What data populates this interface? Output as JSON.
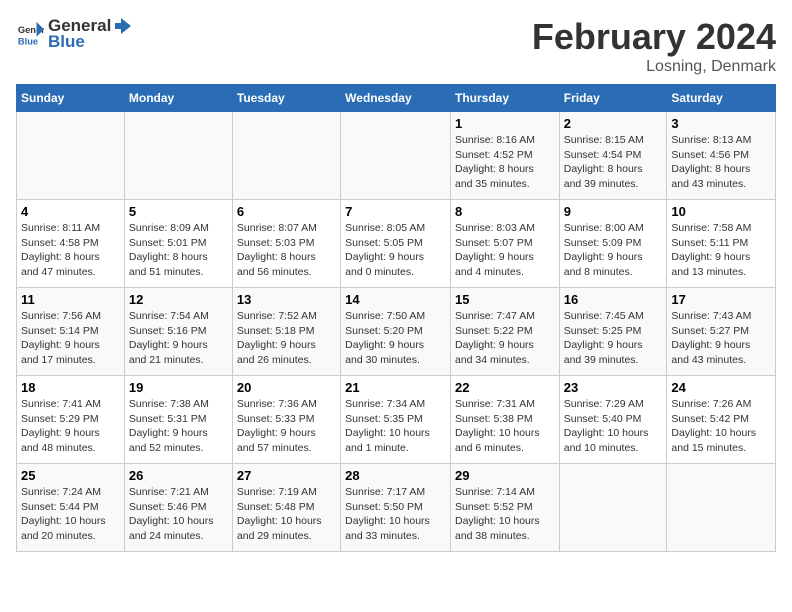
{
  "header": {
    "logo_general": "General",
    "logo_blue": "Blue",
    "month_title": "February 2024",
    "location": "Losning, Denmark"
  },
  "weekdays": [
    "Sunday",
    "Monday",
    "Tuesday",
    "Wednesday",
    "Thursday",
    "Friday",
    "Saturday"
  ],
  "weeks": [
    [
      {
        "day": "",
        "info": ""
      },
      {
        "day": "",
        "info": ""
      },
      {
        "day": "",
        "info": ""
      },
      {
        "day": "",
        "info": ""
      },
      {
        "day": "1",
        "info": "Sunrise: 8:16 AM\nSunset: 4:52 PM\nDaylight: 8 hours\nand 35 minutes."
      },
      {
        "day": "2",
        "info": "Sunrise: 8:15 AM\nSunset: 4:54 PM\nDaylight: 8 hours\nand 39 minutes."
      },
      {
        "day": "3",
        "info": "Sunrise: 8:13 AM\nSunset: 4:56 PM\nDaylight: 8 hours\nand 43 minutes."
      }
    ],
    [
      {
        "day": "4",
        "info": "Sunrise: 8:11 AM\nSunset: 4:58 PM\nDaylight: 8 hours\nand 47 minutes."
      },
      {
        "day": "5",
        "info": "Sunrise: 8:09 AM\nSunset: 5:01 PM\nDaylight: 8 hours\nand 51 minutes."
      },
      {
        "day": "6",
        "info": "Sunrise: 8:07 AM\nSunset: 5:03 PM\nDaylight: 8 hours\nand 56 minutes."
      },
      {
        "day": "7",
        "info": "Sunrise: 8:05 AM\nSunset: 5:05 PM\nDaylight: 9 hours\nand 0 minutes."
      },
      {
        "day": "8",
        "info": "Sunrise: 8:03 AM\nSunset: 5:07 PM\nDaylight: 9 hours\nand 4 minutes."
      },
      {
        "day": "9",
        "info": "Sunrise: 8:00 AM\nSunset: 5:09 PM\nDaylight: 9 hours\nand 8 minutes."
      },
      {
        "day": "10",
        "info": "Sunrise: 7:58 AM\nSunset: 5:11 PM\nDaylight: 9 hours\nand 13 minutes."
      }
    ],
    [
      {
        "day": "11",
        "info": "Sunrise: 7:56 AM\nSunset: 5:14 PM\nDaylight: 9 hours\nand 17 minutes."
      },
      {
        "day": "12",
        "info": "Sunrise: 7:54 AM\nSunset: 5:16 PM\nDaylight: 9 hours\nand 21 minutes."
      },
      {
        "day": "13",
        "info": "Sunrise: 7:52 AM\nSunset: 5:18 PM\nDaylight: 9 hours\nand 26 minutes."
      },
      {
        "day": "14",
        "info": "Sunrise: 7:50 AM\nSunset: 5:20 PM\nDaylight: 9 hours\nand 30 minutes."
      },
      {
        "day": "15",
        "info": "Sunrise: 7:47 AM\nSunset: 5:22 PM\nDaylight: 9 hours\nand 34 minutes."
      },
      {
        "day": "16",
        "info": "Sunrise: 7:45 AM\nSunset: 5:25 PM\nDaylight: 9 hours\nand 39 minutes."
      },
      {
        "day": "17",
        "info": "Sunrise: 7:43 AM\nSunset: 5:27 PM\nDaylight: 9 hours\nand 43 minutes."
      }
    ],
    [
      {
        "day": "18",
        "info": "Sunrise: 7:41 AM\nSunset: 5:29 PM\nDaylight: 9 hours\nand 48 minutes."
      },
      {
        "day": "19",
        "info": "Sunrise: 7:38 AM\nSunset: 5:31 PM\nDaylight: 9 hours\nand 52 minutes."
      },
      {
        "day": "20",
        "info": "Sunrise: 7:36 AM\nSunset: 5:33 PM\nDaylight: 9 hours\nand 57 minutes."
      },
      {
        "day": "21",
        "info": "Sunrise: 7:34 AM\nSunset: 5:35 PM\nDaylight: 10 hours\nand 1 minute."
      },
      {
        "day": "22",
        "info": "Sunrise: 7:31 AM\nSunset: 5:38 PM\nDaylight: 10 hours\nand 6 minutes."
      },
      {
        "day": "23",
        "info": "Sunrise: 7:29 AM\nSunset: 5:40 PM\nDaylight: 10 hours\nand 10 minutes."
      },
      {
        "day": "24",
        "info": "Sunrise: 7:26 AM\nSunset: 5:42 PM\nDaylight: 10 hours\nand 15 minutes."
      }
    ],
    [
      {
        "day": "25",
        "info": "Sunrise: 7:24 AM\nSunset: 5:44 PM\nDaylight: 10 hours\nand 20 minutes."
      },
      {
        "day": "26",
        "info": "Sunrise: 7:21 AM\nSunset: 5:46 PM\nDaylight: 10 hours\nand 24 minutes."
      },
      {
        "day": "27",
        "info": "Sunrise: 7:19 AM\nSunset: 5:48 PM\nDaylight: 10 hours\nand 29 minutes."
      },
      {
        "day": "28",
        "info": "Sunrise: 7:17 AM\nSunset: 5:50 PM\nDaylight: 10 hours\nand 33 minutes."
      },
      {
        "day": "29",
        "info": "Sunrise: 7:14 AM\nSunset: 5:52 PM\nDaylight: 10 hours\nand 38 minutes."
      },
      {
        "day": "",
        "info": ""
      },
      {
        "day": "",
        "info": ""
      }
    ]
  ]
}
